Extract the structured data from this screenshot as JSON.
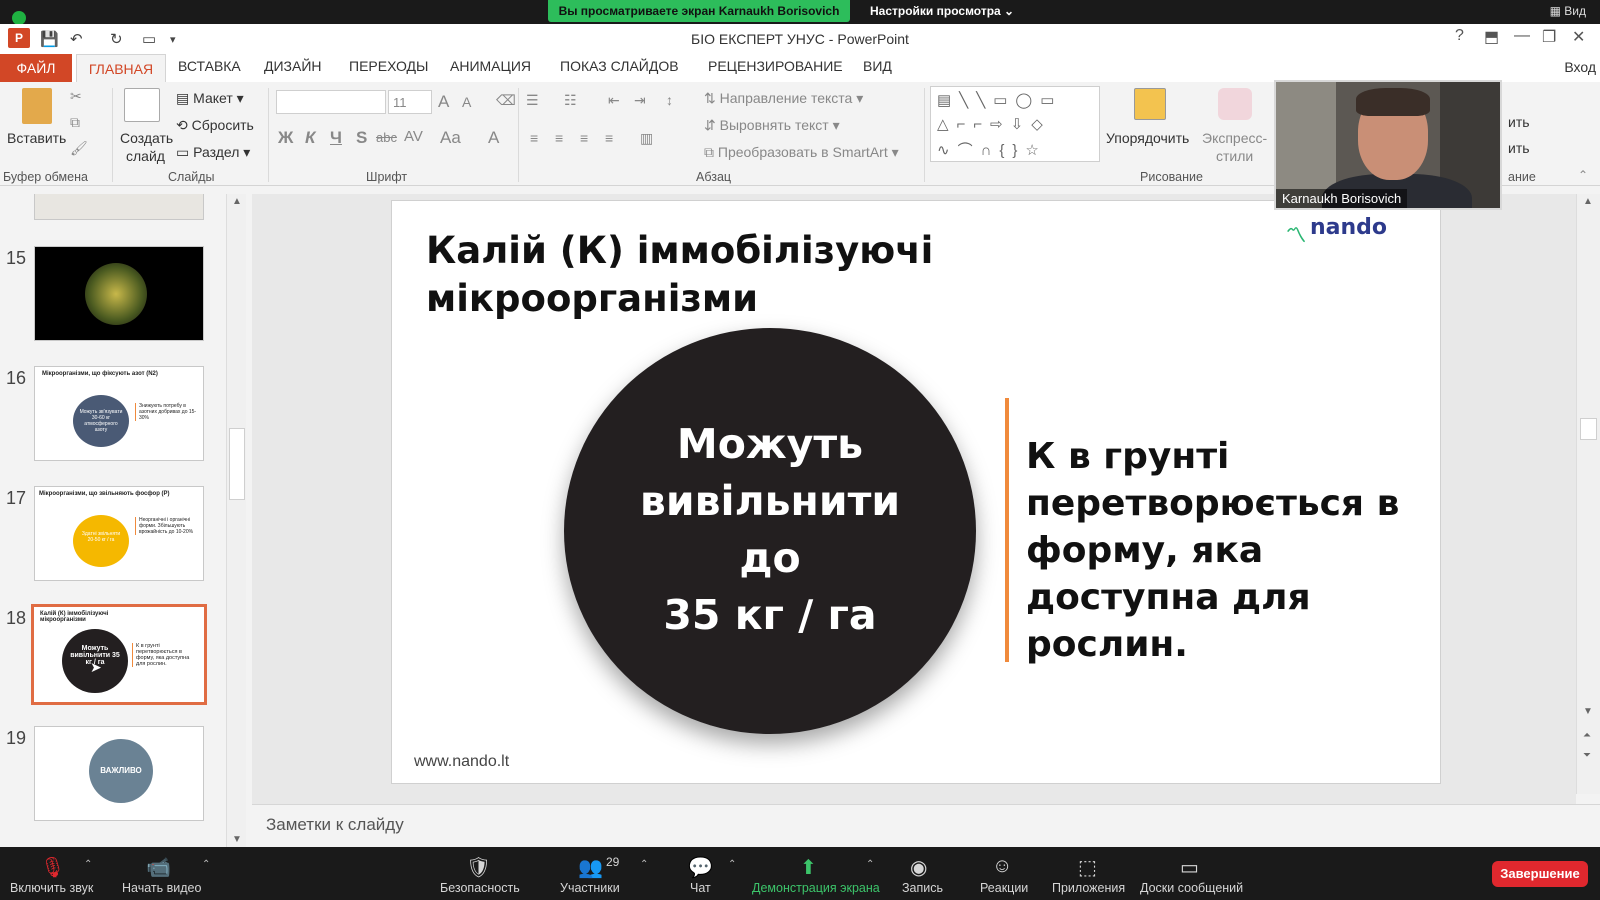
{
  "zoom_top": {
    "share_banner": "Вы просматриваете экран Karnaukh Borisovich",
    "view_options": "Настройки просмотра",
    "view_button": "Вид"
  },
  "window": {
    "title": "БІО ЕКСПЕРТ УНУС - PowerPoint",
    "signin": "Вход"
  },
  "tabs": {
    "file": "ФАЙЛ",
    "home": "ГЛАВНАЯ",
    "insert": "ВСТАВКА",
    "design": "ДИЗАЙН",
    "transitions": "ПЕРЕХОДЫ",
    "animation": "АНИМАЦИЯ",
    "slideshow": "ПОКАЗ СЛАЙДОВ",
    "review": "РЕЦЕНЗИРОВАНИЕ",
    "view": "ВИД"
  },
  "ribbon": {
    "paste": "Вставить",
    "new_slide_1": "Создать",
    "new_slide_2": "слайд",
    "layout": "Макет",
    "reset": "Сбросить",
    "section": "Раздел",
    "font_size": "11",
    "text_direction": "Направление текста",
    "align_text": "Выровнять текст",
    "smartart": "Преобразовать в SmartArt",
    "arrange": "Упорядочить",
    "quick_styles_1": "Экспресс-",
    "quick_styles_2": "стили",
    "group_clipboard": "Буфер обмена",
    "group_slides": "Слайды",
    "group_font": "Шрифт",
    "group_paragraph": "Абзац",
    "group_drawing": "Рисование",
    "group_editing_partial": "ание",
    "edit_partial_1": "ить",
    "edit_partial_2": "ить",
    "bold": "Ж",
    "italic": "К",
    "underline": "Ч",
    "shadow": "S",
    "strike": "abc",
    "spacing": "AV",
    "case": "Aa",
    "font_color": "A",
    "grow": "A",
    "shrink": "A"
  },
  "thumbnails": [
    {
      "num": "15",
      "label": "",
      "kind": "dark"
    },
    {
      "num": "16",
      "label": "Мікроорганізми, що фіксують азот (N2)",
      "circle_color": "#4a5a75",
      "circle_text": "Можуть зв'язувати 30-60 кг атмосферного азоту",
      "side": "Знижують потребу в азотних добривах до 15-30%"
    },
    {
      "num": "17",
      "label": "Мікроорганізми, що звільняють фосфор (P)",
      "circle_color": "#f5b800",
      "circle_text": "Здатні звільняти 20-50 кг / га",
      "side": "Неорганічні і органічні форми. Збільшують врожайність до 10-20%"
    },
    {
      "num": "18",
      "label": "Калій (К) іммобілізуючі мікроорганізми",
      "circle_color": "#231f20",
      "circle_text": "Можуть вивільнити 35 кг / га",
      "side": "К в грунті перетворюється в форму, яка доступна для рослин."
    },
    {
      "num": "19",
      "label": "",
      "circle_color": "#6a8294",
      "circle_text": "ВАЖЛИВО"
    }
  ],
  "slide": {
    "title": "Калій (К) іммобілізуючі мікроорганізми",
    "circle_lines": [
      "Можуть",
      "вивільнити",
      "до",
      "35 кг / га"
    ],
    "side_text": "К в грунті перетворюється в форму, яка доступна для рослин.",
    "footer": "www.nando.lt",
    "brand": "nando",
    "accent_color": "#f08a3c",
    "circle_color": "#231f20"
  },
  "notes_placeholder": "Заметки к слайду",
  "video": {
    "name": "Karnaukh Borisovich"
  },
  "zoom_bottom": {
    "mute": "Включить звук",
    "video": "Начать видео",
    "security": "Безопасность",
    "participants": "Участники",
    "participants_count": "29",
    "chat": "Чат",
    "share": "Демонстрация экрана",
    "record": "Запись",
    "reactions": "Реакции",
    "apps": "Приложения",
    "whiteboards": "Доски сообщений",
    "end": "Завершение"
  }
}
